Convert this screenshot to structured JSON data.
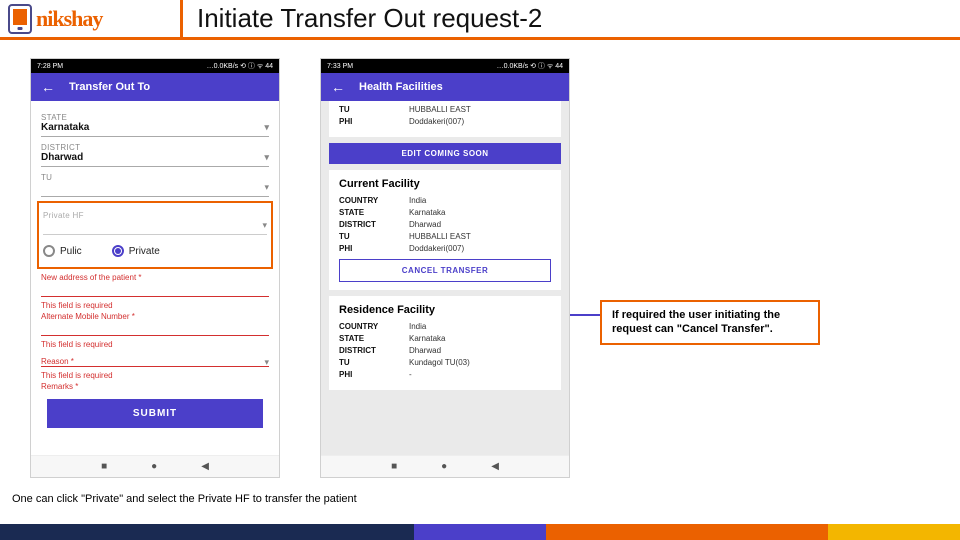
{
  "header": {
    "logo_text": "nikshay",
    "title": "Initiate Transfer Out request-2"
  },
  "phone1": {
    "status_time": "7:28 PM",
    "status_right": "…0.0KB/s ⟲ ⓘ ᯤ 44",
    "appbar_title": "Transfer Out To",
    "state_label": "STATE",
    "state_value": "Karnataka",
    "district_label": "DISTRICT",
    "district_value": "Dharwad",
    "tu_label": "TU",
    "private_hf_label": "Private HF",
    "radio_public": "Pulic",
    "radio_private": "Private",
    "new_address_label": "New address of the patient *",
    "field_required": "This field is required",
    "alt_mobile_label": "Alternate Mobile Number *",
    "reason_label": "Reason *",
    "remarks_label": "Remarks *",
    "submit": "SUBMIT"
  },
  "phone2": {
    "status_time": "7:33 PM",
    "status_right": "…0.0KB/s ⟲ ⓘ ᯤ 44",
    "appbar_title": "Health Facilities",
    "top_tu_label": "TU",
    "top_tu_value": "HUBBALLI EAST",
    "top_phi_label": "PHI",
    "top_phi_value": "Doddakeri(007)",
    "edit_coming": "EDIT COMING SOON",
    "current_title": "Current Facility",
    "residence_title": "Residence Facility",
    "rows_current": [
      {
        "k": "COUNTRY",
        "v": "India"
      },
      {
        "k": "STATE",
        "v": "Karnataka"
      },
      {
        "k": "DISTRICT",
        "v": "Dharwad"
      },
      {
        "k": "TU",
        "v": "HUBBALLI EAST"
      },
      {
        "k": "PHI",
        "v": "Doddakeri(007)"
      }
    ],
    "rows_residence": [
      {
        "k": "COUNTRY",
        "v": "India"
      },
      {
        "k": "STATE",
        "v": "Karnataka"
      },
      {
        "k": "DISTRICT",
        "v": "Dharwad"
      },
      {
        "k": "TU",
        "v": "Kundagol TU(03)"
      },
      {
        "k": "PHI",
        "v": "-"
      }
    ],
    "cancel_transfer": "CANCEL TRANSFER"
  },
  "callouts": {
    "cancel_note": "If required the user initiating the request can \"Cancel Transfer\".",
    "private_note": "One can click \"Private\" and select the Private HF to transfer the patient"
  },
  "nav": {
    "square": "■",
    "circle": "●",
    "tri": "◀"
  }
}
